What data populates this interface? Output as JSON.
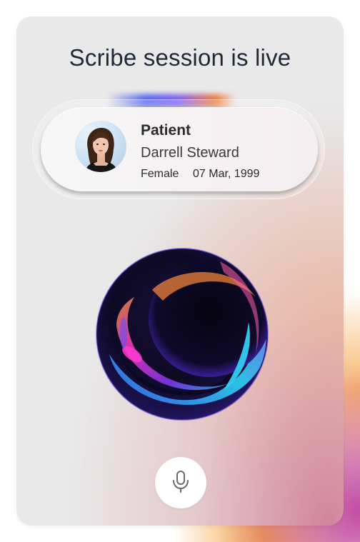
{
  "title": "Scribe session is live",
  "patient": {
    "label": "Patient",
    "name": "Darrell Steward",
    "gender": "Female",
    "dob": "07 Mar, 1999"
  },
  "icons": {
    "mic": "microphone-icon",
    "orb": "ai-orb"
  },
  "colors": {
    "title": "#1f2937",
    "card_bg": "#e9e9e9",
    "orb_accent_blue": "#2fc2ff",
    "orb_accent_purple": "#8a3cff",
    "orb_accent_magenta": "#ff3ad1"
  }
}
